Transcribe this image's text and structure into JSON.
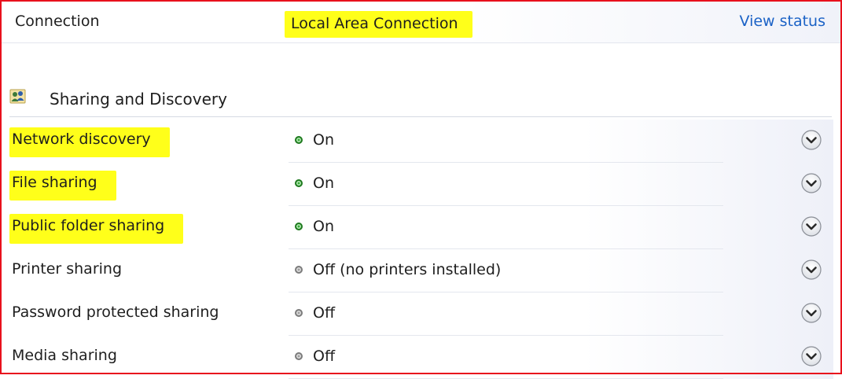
{
  "connection": {
    "label": "Connection",
    "value": "Local Area Connection",
    "link": "View status"
  },
  "section": {
    "title": "Sharing and Discovery",
    "icon": "sharing-people-icon"
  },
  "rows": [
    {
      "label": "Network discovery",
      "status": "On",
      "state": "on",
      "highlighted": true,
      "icon": "chevron-down-icon"
    },
    {
      "label": "File sharing",
      "status": "On",
      "state": "on",
      "highlighted": true,
      "icon": "chevron-down-icon"
    },
    {
      "label": "Public folder sharing",
      "status": "On",
      "state": "on",
      "highlighted": true,
      "icon": "chevron-down-icon"
    },
    {
      "label": "Printer sharing",
      "status": "Off (no printers installed)",
      "state": "off",
      "highlighted": false,
      "icon": "chevron-down-icon"
    },
    {
      "label": "Password protected sharing",
      "status": "Off",
      "state": "off",
      "highlighted": false,
      "icon": "chevron-down-icon"
    },
    {
      "label": "Media sharing",
      "status": "Off",
      "state": "off",
      "highlighted": false,
      "icon": "chevron-down-icon"
    }
  ],
  "colors": {
    "highlight": "#ffff1a",
    "link": "#1b62c6",
    "frame": "#e8101c",
    "status_on": "#3aa83a",
    "status_off": "#9e9e9e"
  }
}
